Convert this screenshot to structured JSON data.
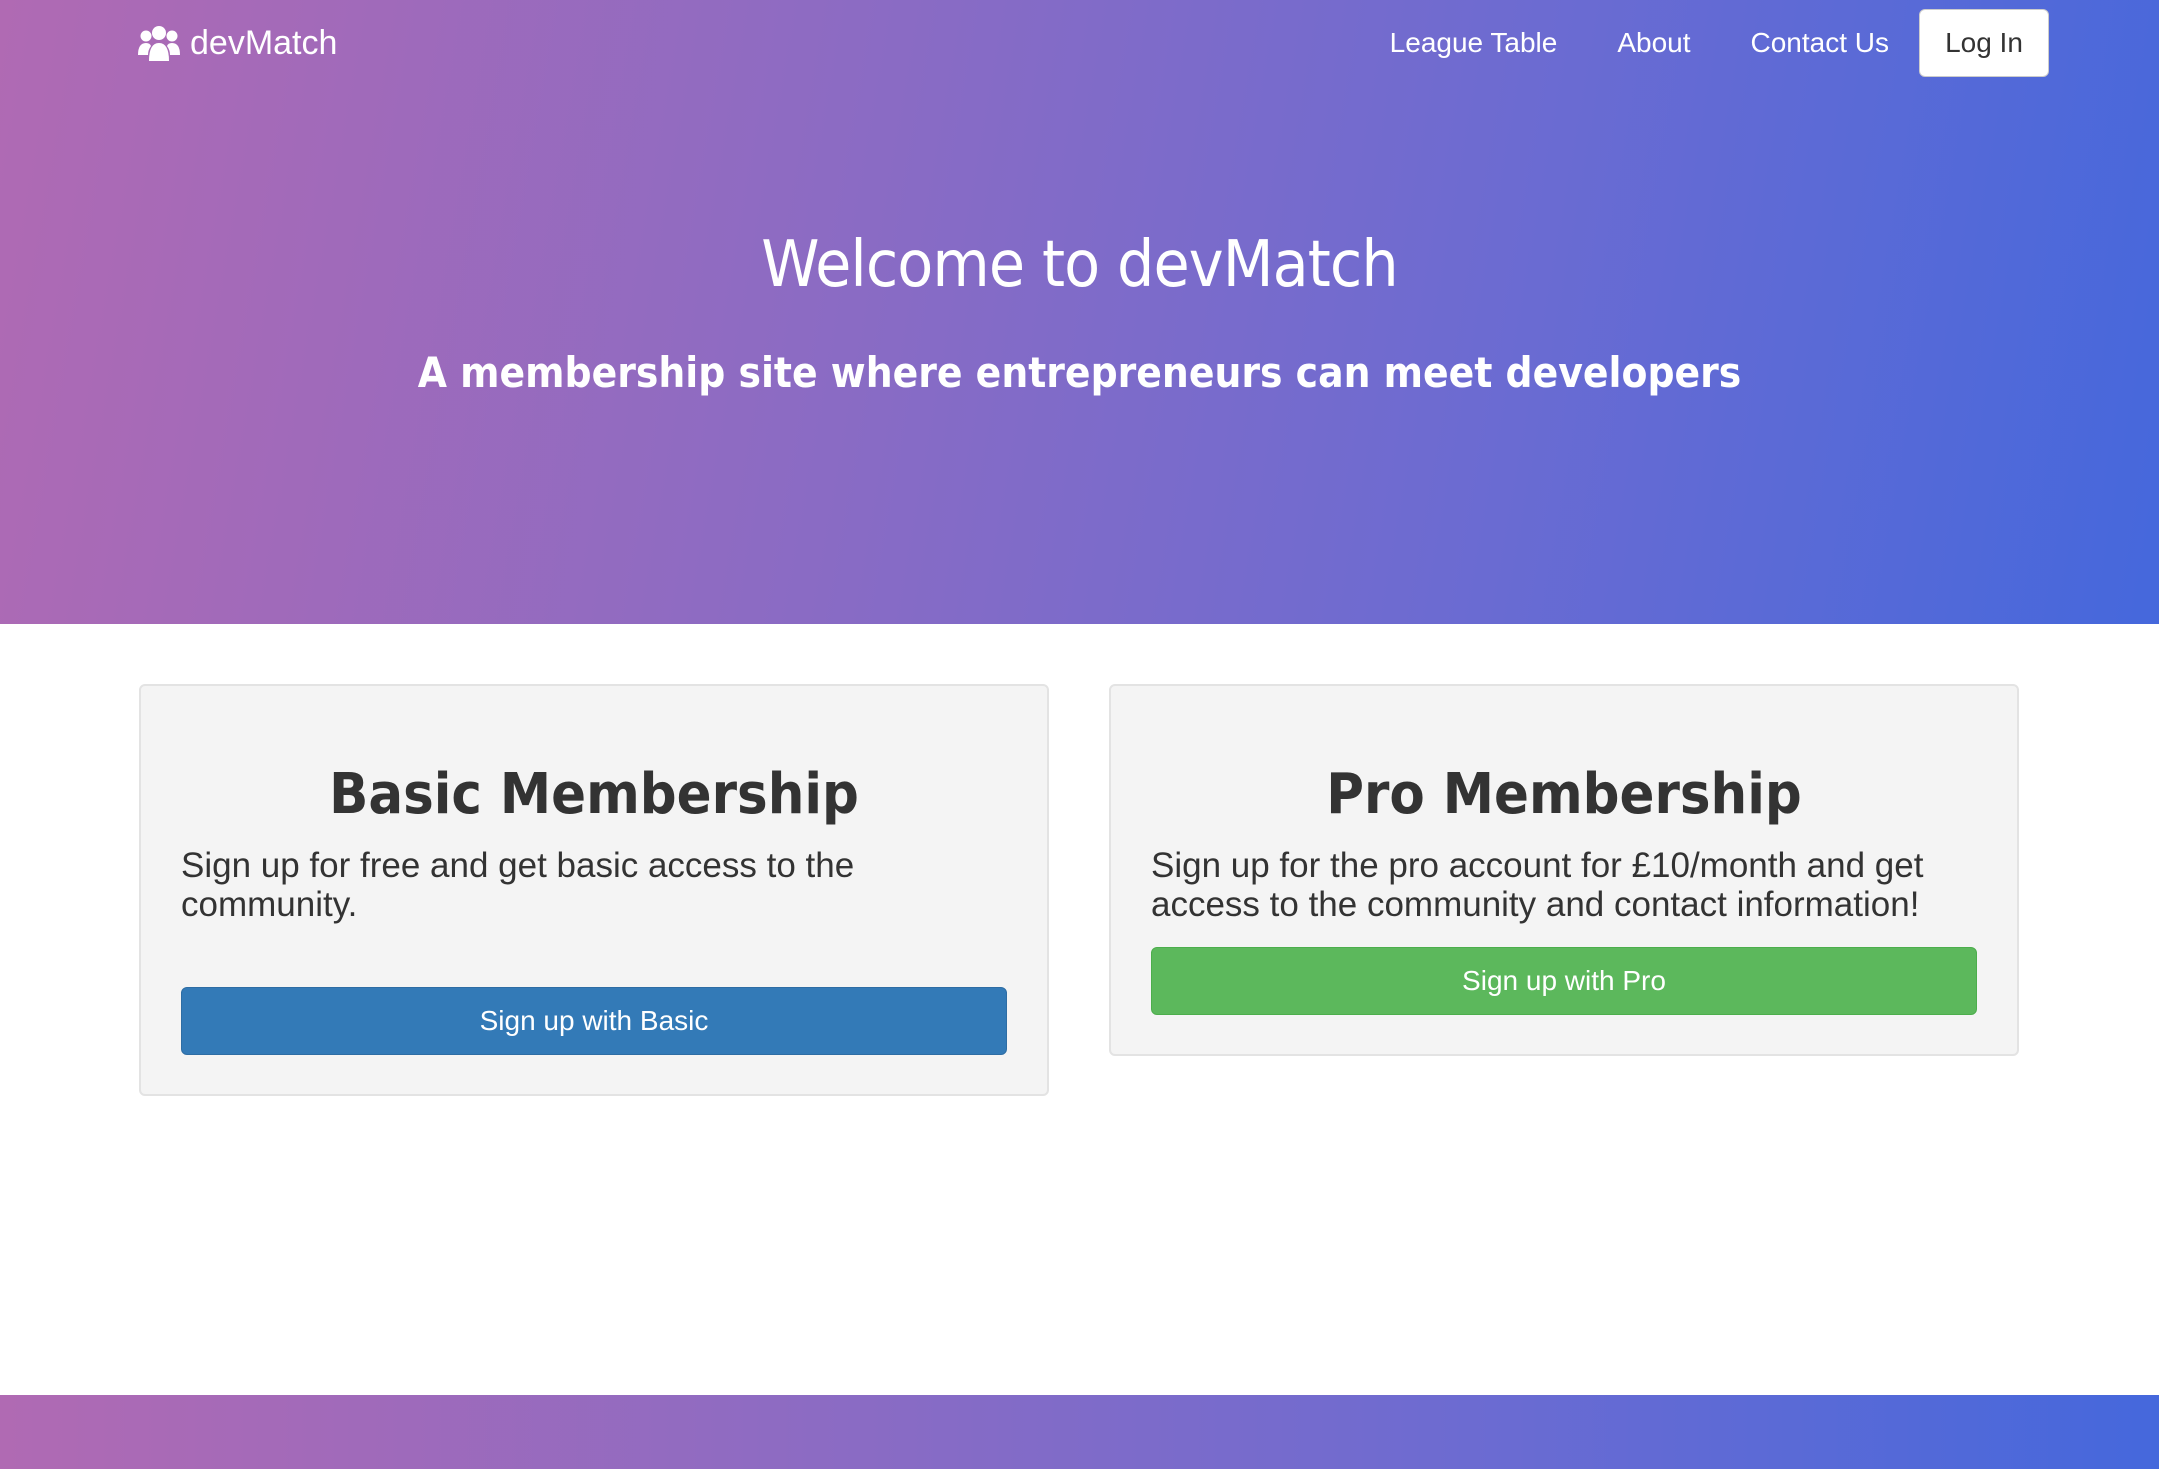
{
  "brand": {
    "name": "devMatch",
    "icon": "users-icon"
  },
  "nav": {
    "links": [
      "League Table",
      "About",
      "Contact Us"
    ],
    "login_label": "Log In"
  },
  "hero": {
    "title": "Welcome to devMatch",
    "subtitle": "A membership site where entrepreneurs can meet developers"
  },
  "plans": {
    "basic": {
      "title": "Basic Membership",
      "description": "Sign up for free and get basic access to the community.",
      "button_label": "Sign up with Basic"
    },
    "pro": {
      "title": "Pro Membership",
      "description": "Sign up for the pro account for £10/month and get access to the community and contact information!",
      "button_label": "Sign up with Pro"
    }
  },
  "colors": {
    "gradient_start": "#b06ab3",
    "gradient_end": "#4568dc",
    "basic_button": "#337ab7",
    "pro_button": "#5cb85c"
  }
}
